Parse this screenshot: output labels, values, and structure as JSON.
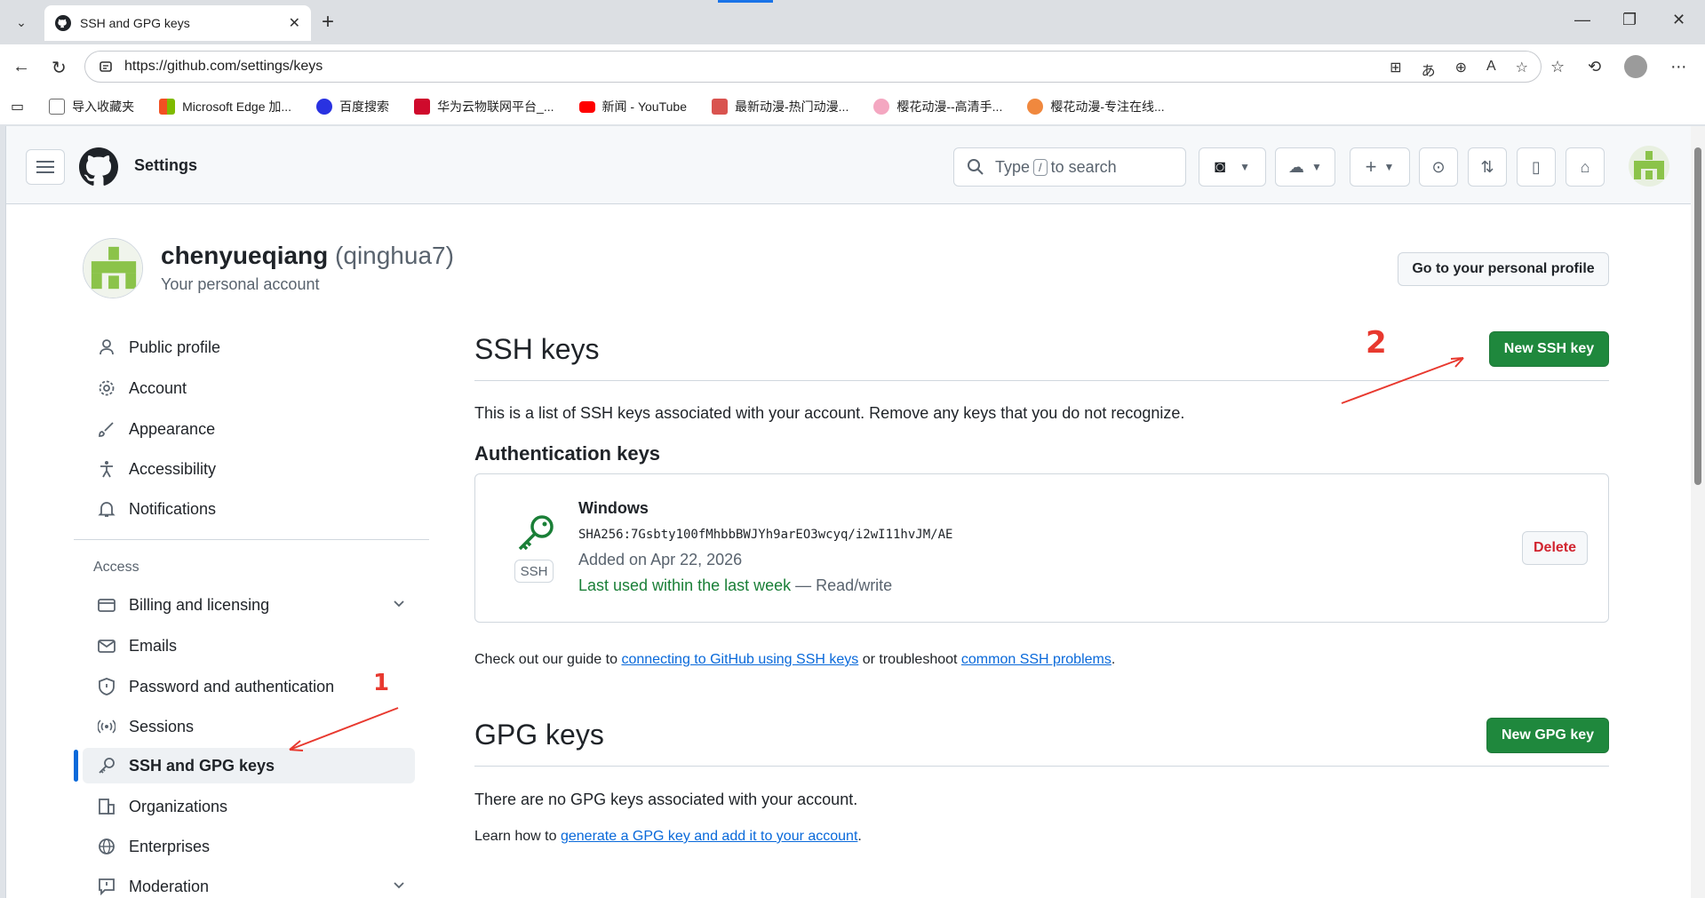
{
  "browser": {
    "tab_title": "SSH and GPG keys",
    "url": "https://github.com/settings/keys",
    "bookmarks": [
      {
        "label": "导入收藏夹",
        "color": "#6b6b6b"
      },
      {
        "label": "Microsoft Edge 加...",
        "color": "#f25022"
      },
      {
        "label": "百度搜索",
        "color": "#2932e1"
      },
      {
        "label": "华为云物联网平台_...",
        "color": "#cf0a2c"
      },
      {
        "label": "新闻 - YouTube",
        "color": "#ff0000"
      },
      {
        "label": "最新动漫-热门动漫...",
        "color": "#d9534f"
      },
      {
        "label": "樱花动漫--高清手...",
        "color": "#f4a7c1"
      },
      {
        "label": "樱花动漫-专注在线...",
        "color": "#f0883e"
      }
    ]
  },
  "header": {
    "title": "Settings",
    "search_type": "Type",
    "search_key": "/",
    "search_rest": "to search"
  },
  "account": {
    "name": "chenyueqiang",
    "login": "(qinghua7)",
    "subtitle": "Your personal account",
    "profile_button": "Go to your personal profile"
  },
  "sidebar": {
    "items": [
      {
        "label": "Public profile",
        "icon": "person-icon"
      },
      {
        "label": "Account",
        "icon": "gear-icon"
      },
      {
        "label": "Appearance",
        "icon": "paintbrush-icon"
      },
      {
        "label": "Accessibility",
        "icon": "accessibility-icon"
      },
      {
        "label": "Notifications",
        "icon": "bell-icon"
      }
    ],
    "access_heading": "Access",
    "access_items": [
      {
        "label": "Billing and licensing",
        "icon": "credit-card-icon"
      },
      {
        "label": "Emails",
        "icon": "mail-icon"
      },
      {
        "label": "Password and authentication",
        "icon": "shield-icon"
      },
      {
        "label": "Sessions",
        "icon": "broadcast-icon"
      },
      {
        "label": "SSH and GPG keys",
        "icon": "key-icon"
      },
      {
        "label": "Organizations",
        "icon": "organization-icon"
      },
      {
        "label": "Enterprises",
        "icon": "globe-icon"
      },
      {
        "label": "Moderation",
        "icon": "report-icon"
      }
    ]
  },
  "ssh": {
    "heading": "SSH keys",
    "new_button": "New SSH key",
    "description": "This is a list of SSH keys associated with your account. Remove any keys that you do not recognize.",
    "auth_heading": "Authentication keys",
    "key": {
      "title": "Windows",
      "fingerprint": "SHA256:7Gsbty100fMhbbBWJYh9arEO3wcyq/i2wI11hvJM/AE",
      "badge": "SSH",
      "added": "Added on Apr 22, 2026",
      "last_used": "Last used within the last week",
      "access": "— Read/write",
      "delete": "Delete"
    },
    "guide_pre": "Check out our guide to",
    "guide_link1": "connecting to GitHub using SSH keys",
    "guide_mid": "or troubleshoot",
    "guide_link2": "common SSH problems",
    "guide_post": "."
  },
  "gpg": {
    "heading": "GPG keys",
    "new_button": "New GPG key",
    "empty": "There are no GPG keys associated with your account.",
    "learn_pre": "Learn how to",
    "learn_link": "generate a GPG key and add it to your account",
    "learn_post": "."
  },
  "annotations": {
    "one": "1",
    "two": "2"
  },
  "colors": {
    "accent": "#0969da",
    "primary_button": "#1f883d",
    "danger": "#d1242f",
    "annotation": "#e8392f"
  }
}
